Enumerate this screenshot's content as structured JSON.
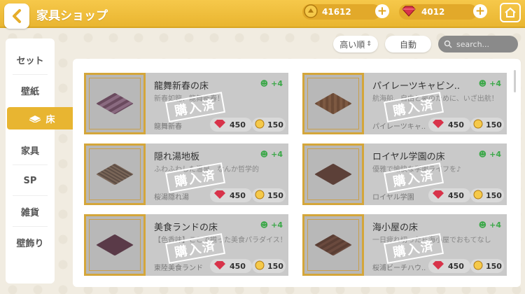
{
  "header": {
    "title": "家具ショップ",
    "coins": "41612",
    "gems": "4012"
  },
  "sidebar": {
    "items": [
      {
        "label": "セット"
      },
      {
        "label": "壁紙"
      },
      {
        "label": "床"
      },
      {
        "label": "家具"
      },
      {
        "label": "SP"
      },
      {
        "label": "雑貨"
      },
      {
        "label": "壁飾り"
      }
    ]
  },
  "controls": {
    "sort": "高い順",
    "auto": "自動",
    "search_placeholder": "search..."
  },
  "cards": [
    {
      "name": "龍舞新春の床",
      "desc": "新春如龍、龍舞新春！",
      "series": "龍舞新春",
      "bonus": "+4",
      "gem_price": "450",
      "coin_price": "150",
      "stamp": "購入済"
    },
    {
      "name": "パイレーツキャビン..",
      "desc": "航海船、自由と夢のために、いざ出航！",
      "series": "パイレーツキャ..",
      "bonus": "+4",
      "gem_price": "450",
      "coin_price": "150",
      "stamp": "購入済"
    },
    {
      "name": "隠れ湯地板",
      "desc": "ふわふわした温泉、なんか哲学的",
      "series": "桜湯隠れ湯",
      "bonus": "+4",
      "gem_price": "450",
      "coin_price": "150",
      "stamp": "購入済"
    },
    {
      "name": "ロイヤル学園の床",
      "desc": "優雅で愉快な学園ライフを♪",
      "series": "ロイヤル学園",
      "bonus": "+4",
      "gem_price": "450",
      "coin_price": "150",
      "stamp": "購入済"
    },
    {
      "name": "美食ランドの床",
      "desc": "【色香味】ここで揃った美食パラダイス！",
      "series": "東陸美食ランド",
      "bonus": "+4",
      "gem_price": "450",
      "coin_price": "150",
      "stamp": "購入済"
    },
    {
      "name": "海小屋の床",
      "desc": "一日疲れ切ったら海小屋でおもてなし",
      "series": "桜浦ビーチハウ..",
      "bonus": "+4",
      "gem_price": "450",
      "coin_price": "150",
      "stamp": "購入済"
    }
  ],
  "colors": {
    "accent": "#e8b531",
    "bonus_green": "#3da84a",
    "gem_red": "#d8334a"
  }
}
